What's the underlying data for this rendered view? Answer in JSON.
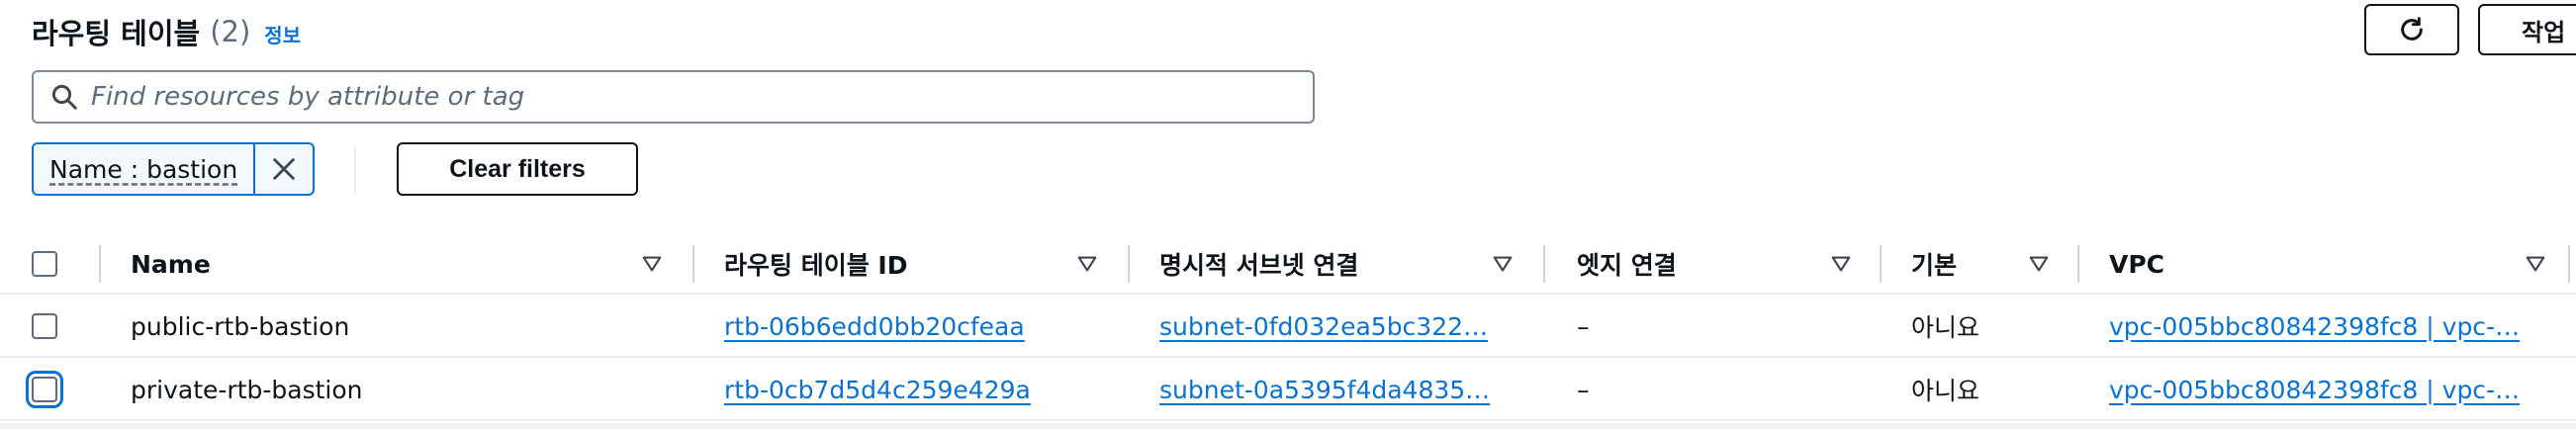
{
  "header": {
    "title": "라우팅 테이블",
    "count": "(2)",
    "info_link": "정보",
    "actions_label": "작업"
  },
  "search": {
    "placeholder": "Find resources by attribute or tag",
    "value": ""
  },
  "filter_token": {
    "label": "Name : bastion"
  },
  "clear_filters_label": "Clear filters",
  "table": {
    "columns": [
      {
        "label": "Name"
      },
      {
        "label": "라우팅 테이블 ID"
      },
      {
        "label": "명시적 서브넷 연결"
      },
      {
        "label": "엣지 연결"
      },
      {
        "label": "기본"
      },
      {
        "label": "VPC"
      }
    ],
    "rows": [
      {
        "name": "public-rtb-bastion",
        "id": "rtb-06b6edd0bb20cfeaa",
        "subnet": "subnet-0fd032ea5bc322…",
        "edge": "–",
        "main": "아니요",
        "vpc": "vpc-005bbc80842398fc8 | vpc-…",
        "selected": false
      },
      {
        "name": "private-rtb-bastion",
        "id": "rtb-0cb7d5d4c259e429a",
        "subnet": "subnet-0a5395f4da4835…",
        "edge": "–",
        "main": "아니요",
        "vpc": "vpc-005bbc80842398fc8 | vpc-…",
        "selected": false
      }
    ]
  },
  "icons": {
    "refresh": "refresh-icon",
    "search": "search-icon",
    "close": "close-icon",
    "sort": "caret-down-icon"
  },
  "colors": {
    "link": "#0972d3",
    "text": "#0f141a",
    "border": "#7d8998",
    "token_bg": "#f2f8fd"
  }
}
